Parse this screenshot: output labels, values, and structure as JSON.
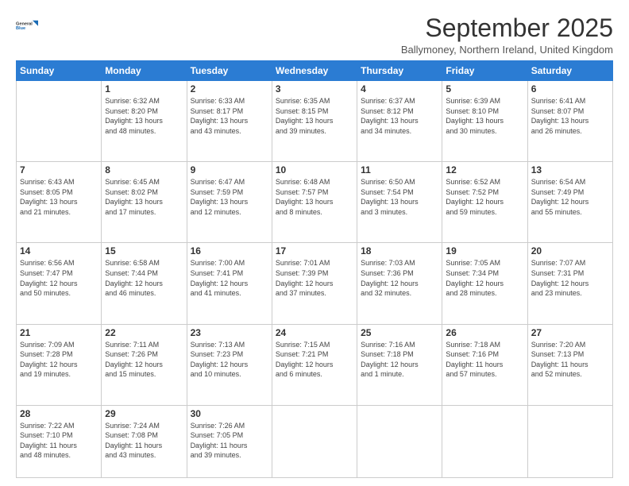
{
  "logo": {
    "line1": "General",
    "line2": "Blue"
  },
  "header": {
    "title": "September 2025",
    "subtitle": "Ballymoney, Northern Ireland, United Kingdom"
  },
  "weekdays": [
    "Sunday",
    "Monday",
    "Tuesday",
    "Wednesday",
    "Thursday",
    "Friday",
    "Saturday"
  ],
  "weeks": [
    [
      {
        "day": "",
        "info": ""
      },
      {
        "day": "1",
        "info": "Sunrise: 6:32 AM\nSunset: 8:20 PM\nDaylight: 13 hours\nand 48 minutes."
      },
      {
        "day": "2",
        "info": "Sunrise: 6:33 AM\nSunset: 8:17 PM\nDaylight: 13 hours\nand 43 minutes."
      },
      {
        "day": "3",
        "info": "Sunrise: 6:35 AM\nSunset: 8:15 PM\nDaylight: 13 hours\nand 39 minutes."
      },
      {
        "day": "4",
        "info": "Sunrise: 6:37 AM\nSunset: 8:12 PM\nDaylight: 13 hours\nand 34 minutes."
      },
      {
        "day": "5",
        "info": "Sunrise: 6:39 AM\nSunset: 8:10 PM\nDaylight: 13 hours\nand 30 minutes."
      },
      {
        "day": "6",
        "info": "Sunrise: 6:41 AM\nSunset: 8:07 PM\nDaylight: 13 hours\nand 26 minutes."
      }
    ],
    [
      {
        "day": "7",
        "info": "Sunrise: 6:43 AM\nSunset: 8:05 PM\nDaylight: 13 hours\nand 21 minutes."
      },
      {
        "day": "8",
        "info": "Sunrise: 6:45 AM\nSunset: 8:02 PM\nDaylight: 13 hours\nand 17 minutes."
      },
      {
        "day": "9",
        "info": "Sunrise: 6:47 AM\nSunset: 7:59 PM\nDaylight: 13 hours\nand 12 minutes."
      },
      {
        "day": "10",
        "info": "Sunrise: 6:48 AM\nSunset: 7:57 PM\nDaylight: 13 hours\nand 8 minutes."
      },
      {
        "day": "11",
        "info": "Sunrise: 6:50 AM\nSunset: 7:54 PM\nDaylight: 13 hours\nand 3 minutes."
      },
      {
        "day": "12",
        "info": "Sunrise: 6:52 AM\nSunset: 7:52 PM\nDaylight: 12 hours\nand 59 minutes."
      },
      {
        "day": "13",
        "info": "Sunrise: 6:54 AM\nSunset: 7:49 PM\nDaylight: 12 hours\nand 55 minutes."
      }
    ],
    [
      {
        "day": "14",
        "info": "Sunrise: 6:56 AM\nSunset: 7:47 PM\nDaylight: 12 hours\nand 50 minutes."
      },
      {
        "day": "15",
        "info": "Sunrise: 6:58 AM\nSunset: 7:44 PM\nDaylight: 12 hours\nand 46 minutes."
      },
      {
        "day": "16",
        "info": "Sunrise: 7:00 AM\nSunset: 7:41 PM\nDaylight: 12 hours\nand 41 minutes."
      },
      {
        "day": "17",
        "info": "Sunrise: 7:01 AM\nSunset: 7:39 PM\nDaylight: 12 hours\nand 37 minutes."
      },
      {
        "day": "18",
        "info": "Sunrise: 7:03 AM\nSunset: 7:36 PM\nDaylight: 12 hours\nand 32 minutes."
      },
      {
        "day": "19",
        "info": "Sunrise: 7:05 AM\nSunset: 7:34 PM\nDaylight: 12 hours\nand 28 minutes."
      },
      {
        "day": "20",
        "info": "Sunrise: 7:07 AM\nSunset: 7:31 PM\nDaylight: 12 hours\nand 23 minutes."
      }
    ],
    [
      {
        "day": "21",
        "info": "Sunrise: 7:09 AM\nSunset: 7:28 PM\nDaylight: 12 hours\nand 19 minutes."
      },
      {
        "day": "22",
        "info": "Sunrise: 7:11 AM\nSunset: 7:26 PM\nDaylight: 12 hours\nand 15 minutes."
      },
      {
        "day": "23",
        "info": "Sunrise: 7:13 AM\nSunset: 7:23 PM\nDaylight: 12 hours\nand 10 minutes."
      },
      {
        "day": "24",
        "info": "Sunrise: 7:15 AM\nSunset: 7:21 PM\nDaylight: 12 hours\nand 6 minutes."
      },
      {
        "day": "25",
        "info": "Sunrise: 7:16 AM\nSunset: 7:18 PM\nDaylight: 12 hours\nand 1 minute."
      },
      {
        "day": "26",
        "info": "Sunrise: 7:18 AM\nSunset: 7:16 PM\nDaylight: 11 hours\nand 57 minutes."
      },
      {
        "day": "27",
        "info": "Sunrise: 7:20 AM\nSunset: 7:13 PM\nDaylight: 11 hours\nand 52 minutes."
      }
    ],
    [
      {
        "day": "28",
        "info": "Sunrise: 7:22 AM\nSunset: 7:10 PM\nDaylight: 11 hours\nand 48 minutes."
      },
      {
        "day": "29",
        "info": "Sunrise: 7:24 AM\nSunset: 7:08 PM\nDaylight: 11 hours\nand 43 minutes."
      },
      {
        "day": "30",
        "info": "Sunrise: 7:26 AM\nSunset: 7:05 PM\nDaylight: 11 hours\nand 39 minutes."
      },
      {
        "day": "",
        "info": ""
      },
      {
        "day": "",
        "info": ""
      },
      {
        "day": "",
        "info": ""
      },
      {
        "day": "",
        "info": ""
      }
    ]
  ]
}
